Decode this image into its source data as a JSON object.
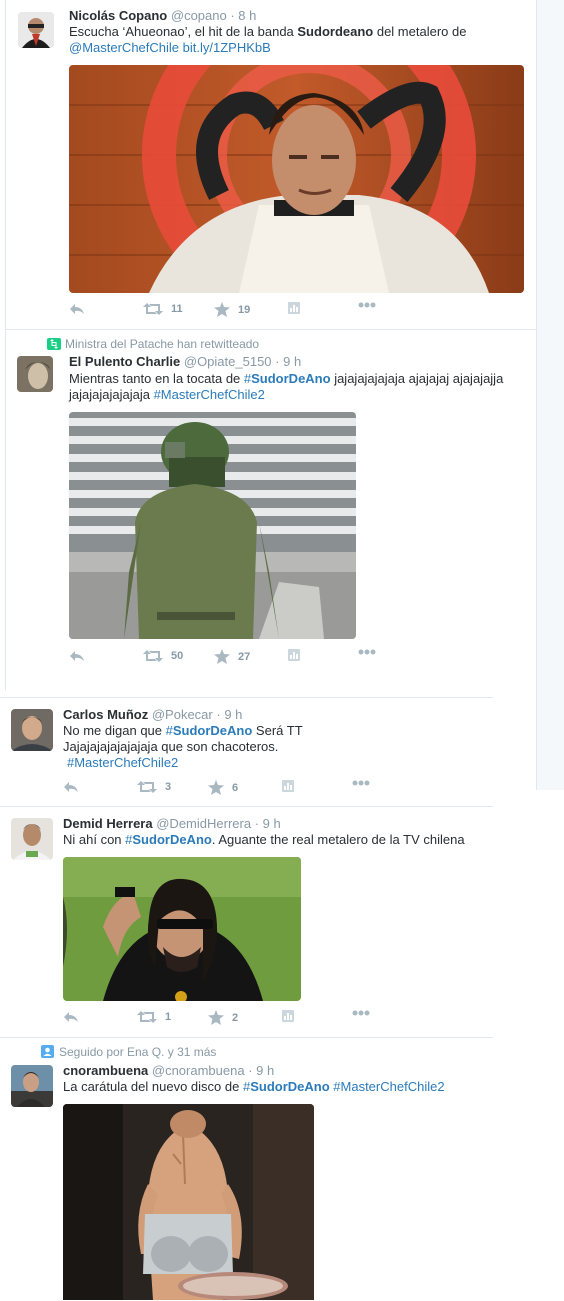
{
  "tweets": [
    {
      "name": "Nicolás Copano",
      "handle": "@copano",
      "time": "· 8 h",
      "text_a": "Escucha ‘Ahueonao’, el hit de la banda ",
      "text_bold": "Sudordeano",
      "text_b": " del metalero de",
      "mention": "@MasterChefChile",
      "link": "bit.ly/1ZPHKbB",
      "retweets": "11",
      "likes": "19"
    },
    {
      "context": "Ministra del Patache han retwitteado",
      "name": "El Pulento Charlie",
      "handle": "@Opiate_5150",
      "time": "· 9 h",
      "text_a": "Mientras tanto en la tocata de ",
      "hash1_prefix": "#",
      "hash1": "SudorDeAno",
      "text_b": " jajajajajajaja ajajajaj ajajajajja",
      "text_c": "jajajajajajajaja ",
      "hash2": "#MasterChefChile2",
      "retweets": "50",
      "likes": "27"
    },
    {
      "name": "Carlos Muñoz",
      "handle": "@Pokecar",
      "time": "· 9 h",
      "text_a": "No me digan que ",
      "hash1_prefix": "#",
      "hash1": "SudorDeAno",
      "text_b": " Será TT",
      "text_c": "Jajajajajajajajaja que son chacoteros.",
      "hash2": "#MasterChefChile2",
      "retweets": "3",
      "likes": "6"
    },
    {
      "name": "Demid Herrera",
      "handle": "@DemidHerrera",
      "time": "· 9 h",
      "text_a": "Ni ahí con ",
      "hash1_prefix": "#",
      "hash1": "SudorDeAno",
      "text_b": ". Aguante the real metalero de la TV chilena",
      "retweets": "1",
      "likes": "2"
    },
    {
      "context": "Seguido por Ena Q. y 31 más",
      "name": "cnorambuena",
      "handle": "@cnorambuena",
      "time": "· 9 h",
      "text_a": "La carátula del nuevo disco de ",
      "hash1_prefix": "#",
      "hash1": "SudorDeAno",
      "hash2": "#MasterChefChile2"
    }
  ],
  "colors": {
    "link": "#2b7bb9",
    "muted": "#8899a6",
    "text": "#292f33",
    "border": "#e1e8ed"
  },
  "icons": [
    "reply-icon",
    "retweet-icon",
    "like-icon",
    "analytics-icon",
    "more-icon",
    "retweet-context-icon",
    "follow-context-icon"
  ]
}
